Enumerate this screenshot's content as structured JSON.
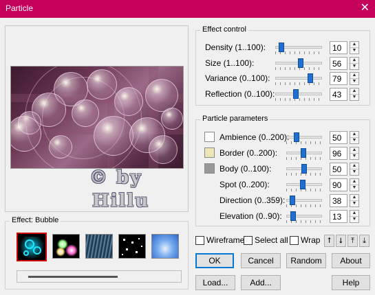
{
  "window": {
    "title": "Particle",
    "close_glyph": "✕"
  },
  "preview": {
    "watermark_line1": "© by",
    "watermark_line2": "Hillu"
  },
  "effect": {
    "label": "Effect: Bubble",
    "thumbnails": [
      {
        "name": "bubble",
        "selected": true
      },
      {
        "name": "sparkle",
        "selected": false
      },
      {
        "name": "rain",
        "selected": false
      },
      {
        "name": "snow",
        "selected": false
      },
      {
        "name": "clouds",
        "selected": false
      }
    ]
  },
  "effect_control": {
    "label": "Effect control",
    "sliders": [
      {
        "label": "Density (1..100):",
        "value": "10",
        "fraction": 0.09
      },
      {
        "label": "Size (1..100):",
        "value": "56",
        "fraction": 0.55
      },
      {
        "label": "Variance (0..100):",
        "value": "79",
        "fraction": 0.79
      },
      {
        "label": "Reflection (0..100):",
        "value": "43",
        "fraction": 0.43
      }
    ]
  },
  "particle_parameters": {
    "label": "Particle parameters",
    "sliders": [
      {
        "label": "Ambience (0..200):",
        "value": "50",
        "fraction": 0.25,
        "swatch": "#ffffff"
      },
      {
        "label": "Border (0..200):",
        "value": "96",
        "fraction": 0.48,
        "swatch": "#ece6b6"
      },
      {
        "label": "Body (0..100):",
        "value": "50",
        "fraction": 0.5,
        "swatch": "#999999"
      },
      {
        "label": "Spot (0..200):",
        "value": "90",
        "fraction": 0.45,
        "swatch": null
      },
      {
        "label": "Direction (0..359):",
        "value": "38",
        "fraction": 0.11,
        "swatch": null
      },
      {
        "label": "Elevation (0..90):",
        "value": "13",
        "fraction": 0.14,
        "swatch": null
      }
    ]
  },
  "options": {
    "wireframe": "Wireframe",
    "select_all": "Select all",
    "wrap": "Wrap"
  },
  "order_buttons": [
    "⭡",
    "⭣",
    "⤒",
    "⤓"
  ],
  "buttons": {
    "ok": "OK",
    "cancel": "Cancel",
    "random": "Random",
    "about": "About",
    "load": "Load...",
    "add": "Add...",
    "help": "Help"
  },
  "colors": {
    "titlebar": "#c5005b",
    "accent": "#1e6fd0",
    "selected_border": "#d00000"
  }
}
